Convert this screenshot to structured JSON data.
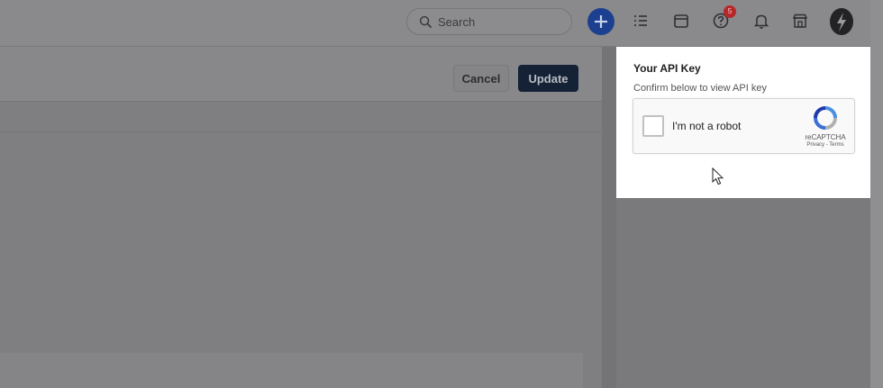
{
  "header": {
    "search_placeholder": "Search",
    "notification_count": "5",
    "icons": [
      "search-icon",
      "plus-icon",
      "list-icon",
      "calendar-icon",
      "help-icon",
      "bell-icon",
      "store-icon",
      "lightning-icon"
    ]
  },
  "toolbar": {
    "cancel_label": "Cancel",
    "update_label": "Update"
  },
  "api_popover": {
    "title": "Your API Key",
    "subtitle": "Confirm below to view API key",
    "captcha": {
      "label": "I'm not a robot",
      "brand": "reCAPTCHA",
      "links": "Privacy - Terms"
    }
  },
  "colors": {
    "accent": "#1d3f90",
    "update_button": "#152235",
    "badge": "#b6282a"
  }
}
